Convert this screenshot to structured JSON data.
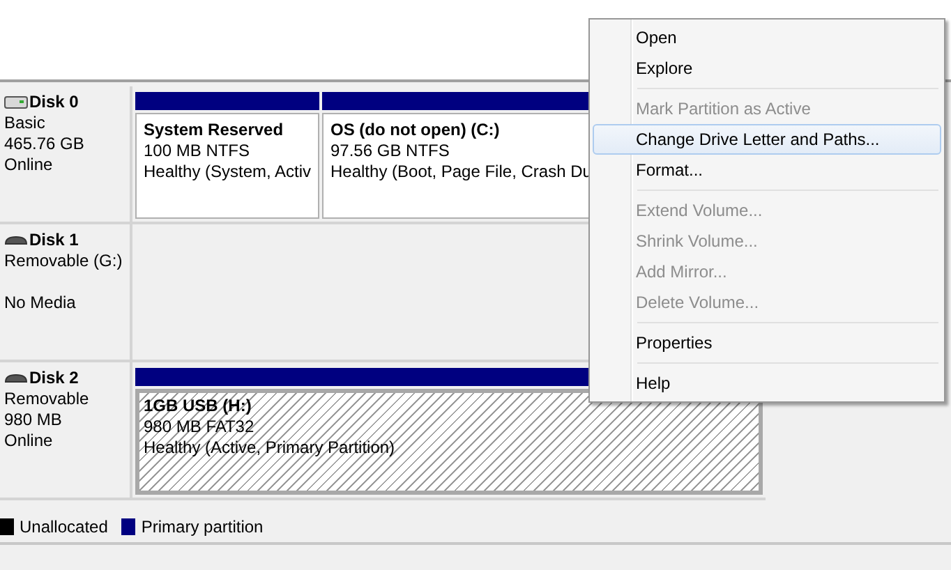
{
  "disks": [
    {
      "name": "Disk 0",
      "kind": "fixed",
      "type": "Basic",
      "size": "465.76 GB",
      "status": "Online",
      "partitions": [
        {
          "title": "System Reserved",
          "size": "100 MB NTFS",
          "health": "Healthy (System, Activ",
          "selected": false
        },
        {
          "title": "OS (do not open)  (C:)",
          "size": "97.56 GB NTFS",
          "health": "Healthy (Boot, Page File, Crash Du",
          "selected": false
        }
      ]
    },
    {
      "name": "Disk 1",
      "kind": "removable",
      "type": "Removable (G:)",
      "status": "No Media"
    },
    {
      "name": "Disk 2",
      "kind": "removable",
      "type": "Removable",
      "size": "980 MB",
      "status": "Online",
      "partitions": [
        {
          "title": "1GB USB  (H:)",
          "size": "980 MB FAT32",
          "health": "Healthy (Active, Primary Partition)",
          "selected": true
        }
      ]
    }
  ],
  "legend": [
    {
      "label": "Unallocated",
      "color": "#000000"
    },
    {
      "label": "Primary partition",
      "color": "#000080"
    }
  ],
  "context_menu": {
    "groups": [
      [
        {
          "label": "Open",
          "disabled": false,
          "selected": false
        },
        {
          "label": "Explore",
          "disabled": false,
          "selected": false
        }
      ],
      [
        {
          "label": "Mark Partition as Active",
          "disabled": true,
          "selected": false
        },
        {
          "label": "Change Drive Letter and Paths...",
          "disabled": false,
          "selected": true
        },
        {
          "label": "Format...",
          "disabled": false,
          "selected": false
        }
      ],
      [
        {
          "label": "Extend Volume...",
          "disabled": true,
          "selected": false
        },
        {
          "label": "Shrink Volume...",
          "disabled": true,
          "selected": false
        },
        {
          "label": "Add Mirror...",
          "disabled": true,
          "selected": false
        },
        {
          "label": "Delete Volume...",
          "disabled": true,
          "selected": false
        }
      ],
      [
        {
          "label": "Properties",
          "disabled": false,
          "selected": false
        }
      ],
      [
        {
          "label": "Help",
          "disabled": false,
          "selected": false
        }
      ]
    ]
  }
}
